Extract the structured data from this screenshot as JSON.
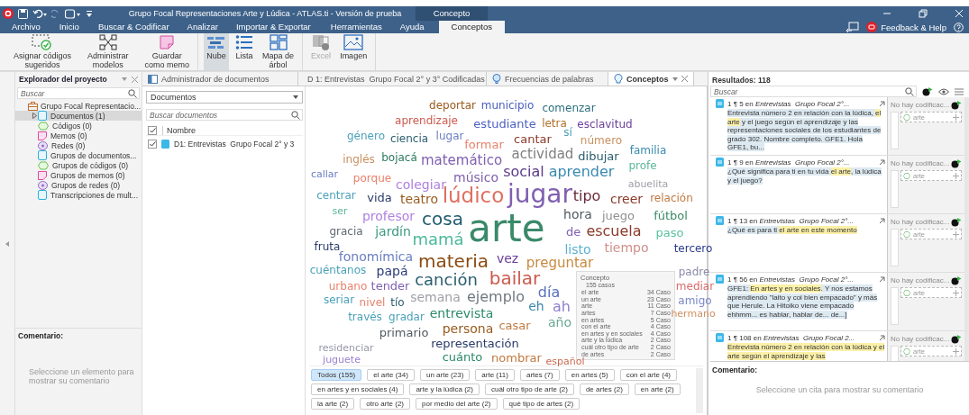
{
  "window": {
    "title": "Grupo Focal Representaciones Arte y Lúdica - ATLAS.ti - Versión de prueba",
    "context_tab": "Concepto"
  },
  "menu": [
    {
      "label": "Archivo",
      "selected": false
    },
    {
      "label": "Inicio",
      "selected": false
    },
    {
      "label": "Buscar & Codificar",
      "selected": false
    },
    {
      "label": "Analizar",
      "selected": false
    },
    {
      "label": "Importar & Exportar",
      "selected": false
    },
    {
      "label": "Herramientas",
      "selected": false
    },
    {
      "label": "Ayuda",
      "selected": false
    },
    {
      "label": "Conceptos",
      "selected": true
    }
  ],
  "feedback": "Feedback & Help",
  "ribbon": [
    {
      "buttons": [
        {
          "label": "Asignar códigos\nsugeridos",
          "selected": false,
          "disabled": false
        },
        {
          "label": "Administrar\nmodelos",
          "selected": false,
          "disabled": false
        },
        {
          "label": "Guardar\ncomo memo",
          "selected": false,
          "disabled": false
        }
      ]
    },
    {
      "buttons": [
        {
          "label": "Nube",
          "selected": true,
          "disabled": false
        },
        {
          "label": "Lista",
          "selected": false,
          "disabled": false
        },
        {
          "label": "Mapa de\nárbol",
          "selected": false,
          "disabled": false
        }
      ]
    },
    {
      "buttons": [
        {
          "label": "Excel",
          "selected": false,
          "disabled": true
        },
        {
          "label": "Imagen",
          "selected": false,
          "disabled": false
        }
      ]
    }
  ],
  "explorer": {
    "title": "Explorador del proyecto",
    "search_placeholder": "Buscar",
    "root": "Grupo Focal Representacio...",
    "items": [
      {
        "label": "Documentos (1)",
        "selected": true,
        "expanded": false
      },
      {
        "label": "Códigos (0)",
        "selected": false
      },
      {
        "label": "Memos (0)",
        "selected": false
      },
      {
        "label": "Redes (0)",
        "selected": false
      },
      {
        "label": "Grupos de documentos...",
        "selected": false
      },
      {
        "label": "Grupos de códigos (0)",
        "selected": false
      },
      {
        "label": "Grupos de memos (0)",
        "selected": false
      },
      {
        "label": "Grupos de redes (0)",
        "selected": false
      },
      {
        "label": "Transcripciones de mult...",
        "selected": false
      }
    ],
    "comment_title": "Comentario:",
    "comment_placeholder": "Seleccione un elemento para mostrar su comentario"
  },
  "tabs": [
    {
      "label": "Administrador de documentos",
      "selected": false
    },
    {
      "label": "D 1: Entrevistas  Grupo Focal 2° y 3° Codificadas",
      "selected": false
    },
    {
      "label": "Frecuencias de palabras",
      "selected": false
    },
    {
      "label": "Conceptos",
      "selected": true
    }
  ],
  "documents": {
    "dropdown": "Documentos",
    "search_placeholder": "Buscar documentos",
    "header": "Nombre",
    "header_checked": true,
    "rows": [
      {
        "name": "D1: Entrevistas  Grupo Focal 2° y 3",
        "checked": true
      }
    ]
  },
  "cloud": [
    {
      "text": "deportar",
      "color": "#9a5b1e"
    },
    {
      "text": "municipio",
      "color": "#4a5fc0"
    },
    {
      "text": "comenzar",
      "color": "#2b6e7e"
    },
    {
      "text": "aprendizaje",
      "color": "#cc5a4e"
    },
    {
      "text": "estudiante",
      "color": "#4a5fc0"
    },
    {
      "text": "letra",
      "color": "#b0702a"
    },
    {
      "text": "esclavitud",
      "color": "#6b3f9a"
    },
    {
      "text": "género",
      "color": "#4aa0b8"
    },
    {
      "text": "ciencia",
      "color": "#2b5d6e"
    },
    {
      "text": "lugar",
      "color": "#6a7fbf"
    },
    {
      "text": "sí",
      "color": "#4aa0b8"
    },
    {
      "text": "formar",
      "color": "#e8826c"
    },
    {
      "text": "cantar",
      "color": "#8a3a2a"
    },
    {
      "text": "número",
      "color": "#c99060"
    },
    {
      "text": "familia",
      "color": "#3a8ab0"
    },
    {
      "text": "inglés",
      "color": "#c99060"
    },
    {
      "text": "bojacá",
      "color": "#2b7a5e"
    },
    {
      "text": "matemático",
      "color": "#8060b0"
    },
    {
      "text": "actividad",
      "color": "#808080"
    },
    {
      "text": "dibujar",
      "color": "#2b5d6e"
    },
    {
      "text": "profe",
      "color": "#5ab89a"
    },
    {
      "text": "callar",
      "color": "#6a7fbf"
    },
    {
      "text": "porque",
      "color": "#e8826c"
    },
    {
      "text": "músico",
      "color": "#8060b0"
    },
    {
      "text": "social",
      "color": "#5a3a8a"
    },
    {
      "text": "aprender",
      "color": "#3a8ab0"
    },
    {
      "text": "colegiar",
      "color": "#b080e0"
    },
    {
      "text": "abuelita",
      "color": "#a0a0a8"
    },
    {
      "text": "centrar",
      "color": "#4aa0b8"
    },
    {
      "text": "vida",
      "color": "#2a3a6a"
    },
    {
      "text": "teatro",
      "color": "#9a5b1e"
    },
    {
      "text": "lúdico",
      "color": "#e07060"
    },
    {
      "text": "jugar",
      "color": "#8060b0"
    },
    {
      "text": "tipo",
      "color": "#6a2a3a"
    },
    {
      "text": "creer",
      "color": "#8a3a2a"
    },
    {
      "text": "relación",
      "color": "#c07a40"
    },
    {
      "text": "ser",
      "color": "#5ab89a"
    },
    {
      "text": "profesor",
      "color": "#b080e0"
    },
    {
      "text": "cosa",
      "color": "#1e5a6e"
    },
    {
      "text": "hora",
      "color": "#505a60"
    },
    {
      "text": "juego",
      "color": "#909090"
    },
    {
      "text": "fútbol",
      "color": "#3a8a6a"
    },
    {
      "text": "gracia",
      "color": "#606870"
    },
    {
      "text": "jardín",
      "color": "#3a9a80"
    },
    {
      "text": "mamá",
      "color": "#4ab89a"
    },
    {
      "text": "arte",
      "color": "#3a8a6a"
    },
    {
      "text": "de",
      "color": "#8060b0"
    },
    {
      "text": "escuela",
      "color": "#8a3a2a"
    },
    {
      "text": "paso",
      "color": "#5ac0a0"
    },
    {
      "text": "fruta",
      "color": "#2a3a6a"
    },
    {
      "text": "listo",
      "color": "#5ab0d0"
    },
    {
      "text": "tiempo",
      "color": "#d0908a"
    },
    {
      "text": "tercero",
      "color": "#2a3a8a"
    },
    {
      "text": "fonomímica",
      "color": "#6a7fbf"
    },
    {
      "text": "materia",
      "color": "#8a4a10"
    },
    {
      "text": "vez",
      "color": "#6b3f9a"
    },
    {
      "text": "preguntar",
      "color": "#c88a40"
    },
    {
      "text": "cuéntanos",
      "color": "#4aa0b8"
    },
    {
      "text": "papá",
      "color": "#2a3a7a"
    },
    {
      "text": "canción",
      "color": "#2b5d6e"
    },
    {
      "text": "bailar",
      "color": "#cc5a4e"
    },
    {
      "text": "padre",
      "color": "#8a8aa8"
    },
    {
      "text": "día",
      "color": "#5a70c0"
    },
    {
      "text": "urbano",
      "color": "#e8826c"
    },
    {
      "text": "tender",
      "color": "#8060b0"
    },
    {
      "text": "mediar",
      "color": "#d86a6a"
    },
    {
      "text": "ah",
      "color": "#9080d0"
    },
    {
      "text": "año",
      "color": "#6aa890"
    },
    {
      "text": "seriar",
      "color": "#4aa0b8"
    },
    {
      "text": "nivel",
      "color": "#e8826c"
    },
    {
      "text": "tío",
      "color": "#2b5d6e"
    },
    {
      "text": "semana",
      "color": "#a0a0a8"
    },
    {
      "text": "ejemplo",
      "color": "#707880"
    },
    {
      "text": "eh",
      "color": "#3a8ab0"
    },
    {
      "text": "amigo",
      "color": "#7a88c8"
    },
    {
      "text": "través",
      "color": "#4aa0b8"
    },
    {
      "text": "gradar",
      "color": "#4aa0b8"
    },
    {
      "text": "entrevista",
      "color": "#2b8a6a"
    },
    {
      "text": "hermano",
      "color": "#d09060"
    },
    {
      "text": "casar",
      "color": "#c07a40"
    },
    {
      "text": "residenciar",
      "color": "#9898a8"
    },
    {
      "text": "primario",
      "color": "#505a60"
    },
    {
      "text": "persona",
      "color": "#9a5b1e"
    },
    {
      "text": "español",
      "color": "#c86a50"
    },
    {
      "text": "representación",
      "color": "#2a3a6a"
    },
    {
      "text": "juguete",
      "color": "#9a80d0"
    },
    {
      "text": "cuánto",
      "color": "#2b8a6a"
    },
    {
      "text": "nombrar",
      "color": "#c07a40"
    }
  ],
  "tooltip": {
    "title": "Concepto",
    "count": "155 casos",
    "rows": [
      {
        "label": "el arte",
        "count": "34 Caso"
      },
      {
        "label": "un arte",
        "count": "23 Caso"
      },
      {
        "label": "arte",
        "count": "11 Caso"
      },
      {
        "label": "artes",
        "count": "7 Caso"
      },
      {
        "label": "en artes",
        "count": "5 Caso"
      },
      {
        "label": "con el arte",
        "count": "4 Caso"
      },
      {
        "label": "en artes y en sociales",
        "count": "4 Caso"
      },
      {
        "label": "arte y la lúdica",
        "count": "2 Caso"
      },
      {
        "label": "cuál otro tipo de arte",
        "count": "2 Caso"
      },
      {
        "label": "de artes",
        "count": "2 Caso"
      }
    ]
  },
  "chips": [
    {
      "label": "Todos (155)",
      "selected": true
    },
    {
      "label": "el arte (34)",
      "selected": false
    },
    {
      "label": "un arte (23)",
      "selected": false
    },
    {
      "label": "arte (11)",
      "selected": false
    },
    {
      "label": "artes (7)",
      "selected": false
    },
    {
      "label": "en artes (5)",
      "selected": false
    },
    {
      "label": "con el arte (4)",
      "selected": false
    },
    {
      "label": "en artes y en sociales (4)",
      "selected": false
    },
    {
      "label": "arte y la lúdica (2)",
      "selected": false
    },
    {
      "label": "cuál otro tipo de arte (2)",
      "selected": false
    },
    {
      "label": "de artes (2)",
      "selected": false
    },
    {
      "label": "en arte (2)",
      "selected": false
    },
    {
      "label": "la arte (2)",
      "selected": false
    },
    {
      "label": "otro arte (2)",
      "selected": false
    },
    {
      "label": "por medio del arte (2)",
      "selected": false
    },
    {
      "label": "qué tipo de artes (2)",
      "selected": false
    }
  ],
  "results": {
    "title": "Resultados: 118",
    "search_placeholder": "Buscar",
    "comment_title": "Comentario:",
    "comment_placeholder": "Seleccione un cita para mostrar su comentario",
    "items": [
      {
        "header": "1 ¶ 5 en *Entrevistas  Grupo Focal 2°...*",
        "codes_status": "No hay codificac...",
        "code": "arte",
        "quote": [
          {
            "text": "Entrevista número 2 en relación con la lúdica, ",
            "highlight": false
          },
          {
            "text": "el arte",
            "highlight": true
          },
          {
            "text": " y el juego según el aprendizaje y las representaciones sociales de los estudiantes de grado 302. Nombre completo. GFE1. Hola GFE1, bu...",
            "highlight": false
          }
        ]
      },
      {
        "header": "1 ¶ 9 en *Entrevistas  Grupo Focal 2°...*",
        "codes_status": "No hay codificac...",
        "code": "arte",
        "quote": [
          {
            "text": "¿Qué significa para ti en tu vida ",
            "highlight": false
          },
          {
            "text": "el arte",
            "highlight": true
          },
          {
            "text": ", la lúdica y el juego?",
            "highlight": false
          }
        ]
      },
      {
        "header": "1 ¶ 13 en *Entrevistas  Grupo Focal 2°...*",
        "codes_status": "No hay codificac...",
        "code": "arte",
        "quote": [
          {
            "text": "¿Qué es para ti ",
            "highlight": false
          },
          {
            "text": "el arte en este momento",
            "highlight": true
          }
        ]
      },
      {
        "header": "1 ¶ 56 en *Entrevistas  Grupo Focal 2°...*",
        "codes_status": "No hay codificac...",
        "code": "arte",
        "quote": [
          {
            "text": "GFE1: ",
            "highlight": false
          },
          {
            "text": "En artes y en sociales",
            "highlight": true
          },
          {
            "text": ". Y nos estamos aprendiendo \"laito y coi bien empacado\" y más que Herule. La Hitoiko viene empacado ehhmm... es hablar, hablar de... de...]",
            "highlight": false
          }
        ]
      },
      {
        "header": "1 ¶ 108 en *Entrevistas  Grupo Focal 2...*",
        "codes_status": "No hay codificac...",
        "code": "arte",
        "quote": [
          {
            "text": "Entrevista número 2 en relación con la lúdica y el arte según el aprendizaje y las",
            "highlight": true
          }
        ]
      }
    ]
  }
}
